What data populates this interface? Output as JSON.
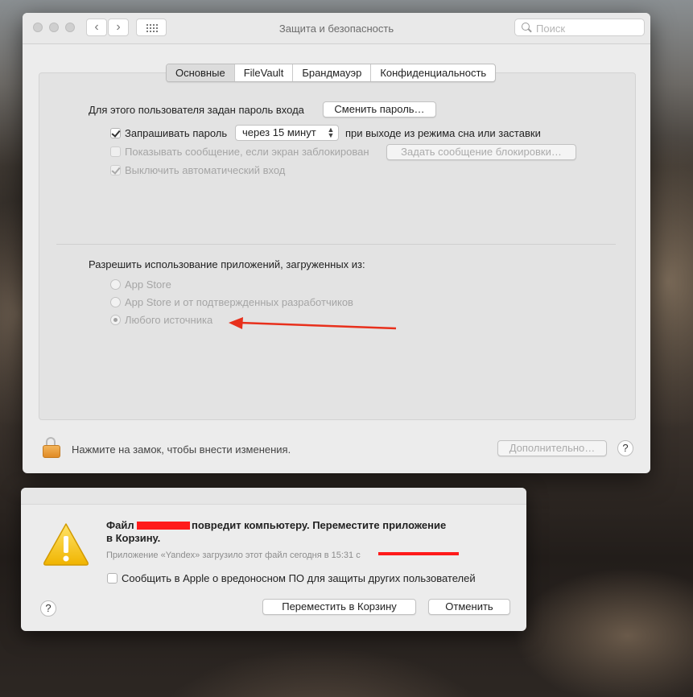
{
  "window": {
    "title": "Защита и безопасность",
    "search_placeholder": "Поиск",
    "tabs": [
      "Основные",
      "FileVault",
      "Брандмауэр",
      "Конфиденциальность"
    ],
    "active_tab": "Основные",
    "password_text": "Для этого пользователя задан пароль входа",
    "change_password_button": "Сменить пароль…",
    "require_password_label": "Запрашивать пароль",
    "require_password_checked": true,
    "require_password_delay": "через 15 минут",
    "require_password_suffix": "при выходе из режима сна или заставки",
    "show_message_label": "Показывать сообщение, если экран заблокирован",
    "show_message_checked": false,
    "set_message_button": "Задать сообщение блокировки…",
    "disable_autologin_label": "Выключить автоматический вход",
    "disable_autologin_checked": true,
    "allow_apps_label": "Разрешить использование приложений, загруженных из:",
    "allow_options": [
      {
        "label": "App Store",
        "selected": false
      },
      {
        "label": "App Store и от подтвержденных разработчиков",
        "selected": false
      },
      {
        "label": "Любого источника",
        "selected": true
      }
    ],
    "lock_text": "Нажмите на замок, чтобы внести изменения.",
    "advanced_button": "Дополнительно…",
    "help_label": "?"
  },
  "dialog": {
    "title_prefix": "Файл",
    "title_suffix": "повредит компьютеру. Переместите приложение",
    "title_line2": "в Корзину.",
    "info_text": "Приложение «Yandex» загрузило этот файл сегодня в 15:31 с",
    "report_label": "Сообщить в Apple о вредоносном ПО для защиты других пользователей",
    "report_checked": false,
    "move_to_trash_button": "Переместить в Корзину",
    "cancel_button": "Отменить",
    "help_label": "?"
  },
  "colors": {
    "annotation_arrow": "#e8301c",
    "redaction": "#ff1a1a",
    "lock": "#e8982f",
    "warning": "#f5c518"
  }
}
